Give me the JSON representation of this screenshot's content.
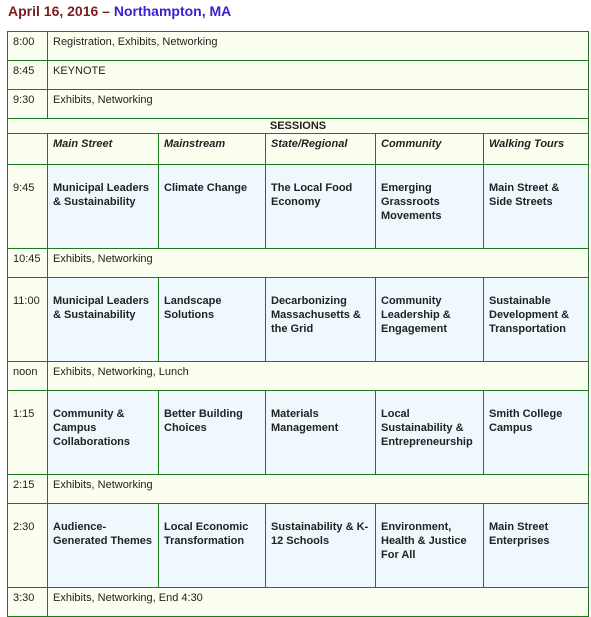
{
  "header": {
    "date": "April 16, 2016",
    "separator": "–",
    "location": "Northampton, MA"
  },
  "schedule": {
    "sessions_label": "SESSIONS",
    "tracks": [
      "Main Street",
      "Mainstream",
      "State/Regional",
      "Community",
      "Walking Tours"
    ],
    "pre_rows": [
      {
        "time": "8:00",
        "text": "Registration, Exhibits, Networking"
      },
      {
        "time": "8:45",
        "text": "KEYNOTE"
      },
      {
        "time": "9:30",
        "text": "Exhibits, Networking"
      }
    ],
    "blocks": [
      {
        "time": "9:45",
        "sessions": [
          "Municipal Leaders & Sustainability",
          "Climate Change",
          "The Local Food Economy",
          "Emerging Grassroots Movements",
          "Main Street & Side Streets"
        ]
      },
      {
        "break_time": "10:45",
        "break_text": "Exhibits, Networking"
      },
      {
        "time": "11:00",
        "sessions": [
          "Municipal Leaders & Sustainability",
          "Landscape Solutions",
          "Decarbonizing Massachusetts & the Grid",
          "Community Leadership & Engagement",
          "Sustainable Development & Transportation"
        ]
      },
      {
        "break_time": "noon",
        "break_text": "Exhibits, Networking, Lunch"
      },
      {
        "time": "1:15",
        "sessions": [
          "Community & Campus Collaborations",
          "Better Building Choices",
          "Materials Management",
          "Local Sustainability & Entrepreneurship",
          "Smith College Campus"
        ]
      },
      {
        "break_time": "2:15",
        "break_text": "Exhibits, Networking"
      },
      {
        "time": "2:30",
        "sessions": [
          "Audience-Generated Themes",
          "Local Economic Transformation",
          "Sustainability & K-12 Schools",
          "Environment, Health & Justice For All",
          "Main Street Enterprises"
        ]
      },
      {
        "break_time": "3:30",
        "break_text": "Exhibits, Networking, End 4:30"
      }
    ]
  }
}
